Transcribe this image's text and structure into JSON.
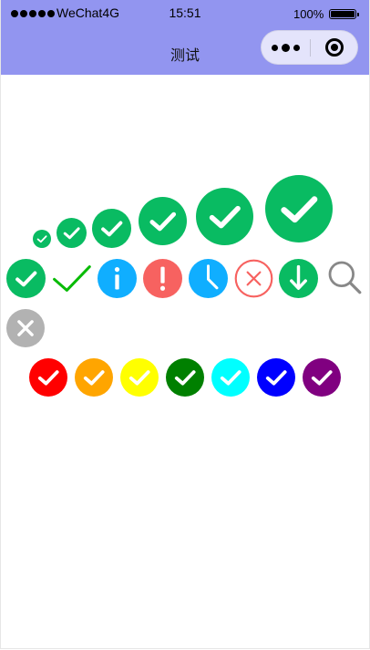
{
  "status_bar": {
    "carrier": "WeChat4G",
    "time": "15:51",
    "battery_percent": "100%",
    "battery_level": 1.0
  },
  "nav": {
    "title": "测试",
    "more_icon": "more-dots-icon",
    "close_icon": "miniprogram-close-icon",
    "background_color": "#9295f0"
  },
  "icon_rows": {
    "success_sizes": {
      "icon": "success-icon",
      "color": "#09bb62",
      "count": 6
    },
    "types": [
      {
        "icon": "success-icon",
        "color": "#09bb62"
      },
      {
        "icon": "success-no-circle-icon",
        "color": "#09bb07"
      },
      {
        "icon": "info-icon",
        "color": "#10aeff"
      },
      {
        "icon": "warn-icon",
        "color": "#f76260"
      },
      {
        "icon": "waiting-icon",
        "color": "#10aeff"
      },
      {
        "icon": "cancel-icon",
        "color": "#f76260"
      },
      {
        "icon": "download-icon",
        "color": "#09bb62"
      },
      {
        "icon": "search-icon",
        "color": "#888888"
      },
      {
        "icon": "clear-icon",
        "color": "#b2b2b2"
      }
    ],
    "colors": [
      {
        "icon": "success-icon",
        "color": "#ff0000"
      },
      {
        "icon": "success-icon",
        "color": "#ffa500"
      },
      {
        "icon": "success-icon",
        "color": "#ffff00"
      },
      {
        "icon": "success-icon",
        "color": "#008000"
      },
      {
        "icon": "success-icon",
        "color": "#00ffff"
      },
      {
        "icon": "success-icon",
        "color": "#0000ff"
      },
      {
        "icon": "success-icon",
        "color": "#800080"
      }
    ]
  }
}
